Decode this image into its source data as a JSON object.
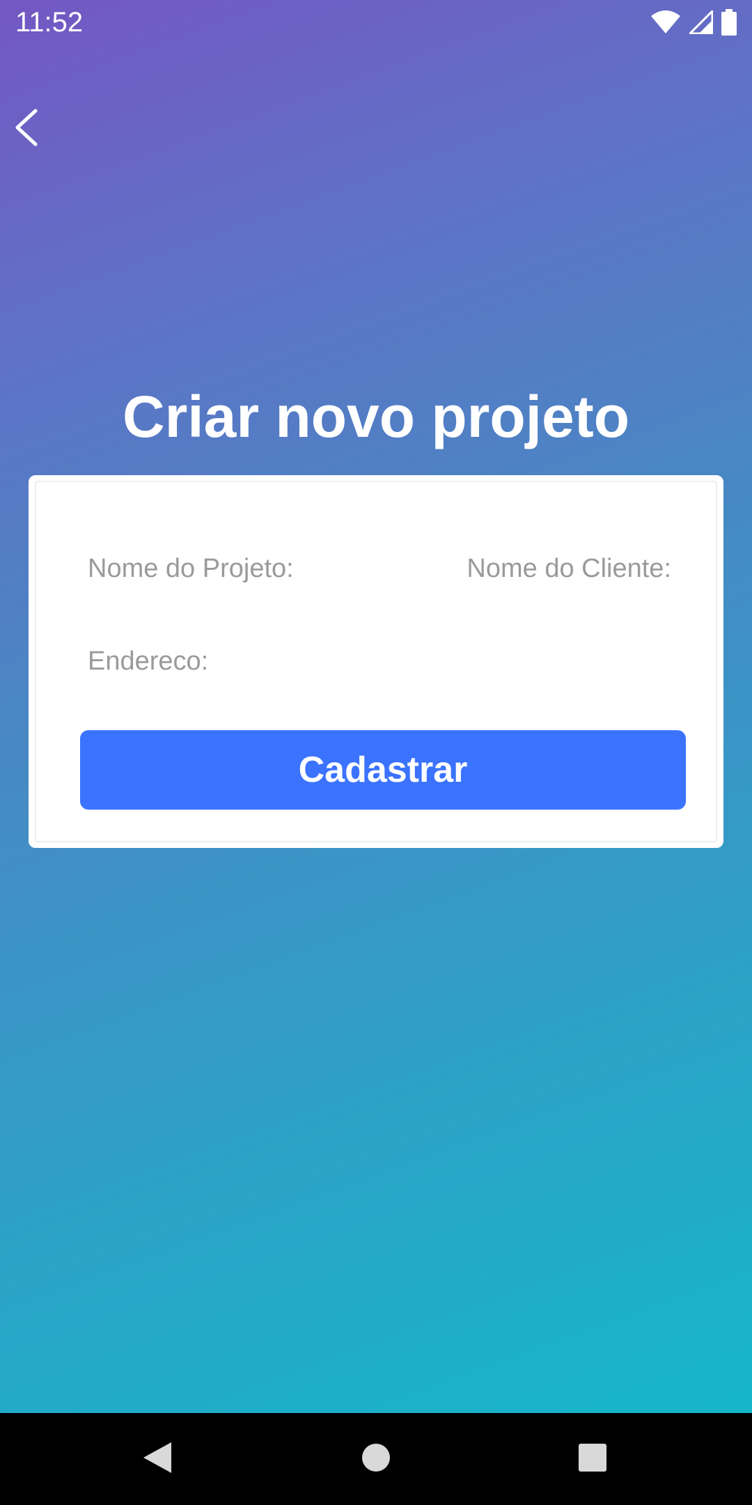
{
  "status_bar": {
    "time": "11:52",
    "icons": [
      "wifi-icon",
      "signal-icon",
      "battery-icon"
    ]
  },
  "header": {
    "back_icon": "chevron-left-icon"
  },
  "page": {
    "title": "Criar novo projeto"
  },
  "form": {
    "project_name_label": "Nome do Projeto:",
    "client_name_label": "Nome do Cliente:",
    "address_label": "Endereco:",
    "submit_label": "Cadastrar"
  },
  "nav_bar": {
    "icons": [
      "nav-back-icon",
      "nav-home-icon",
      "nav-recents-icon"
    ]
  },
  "colors": {
    "gradient_start": "#7457c3",
    "gradient_end": "#12bacb",
    "button": "#3b73ff",
    "label_text": "#9a9a9a",
    "card": "#ffffff"
  }
}
